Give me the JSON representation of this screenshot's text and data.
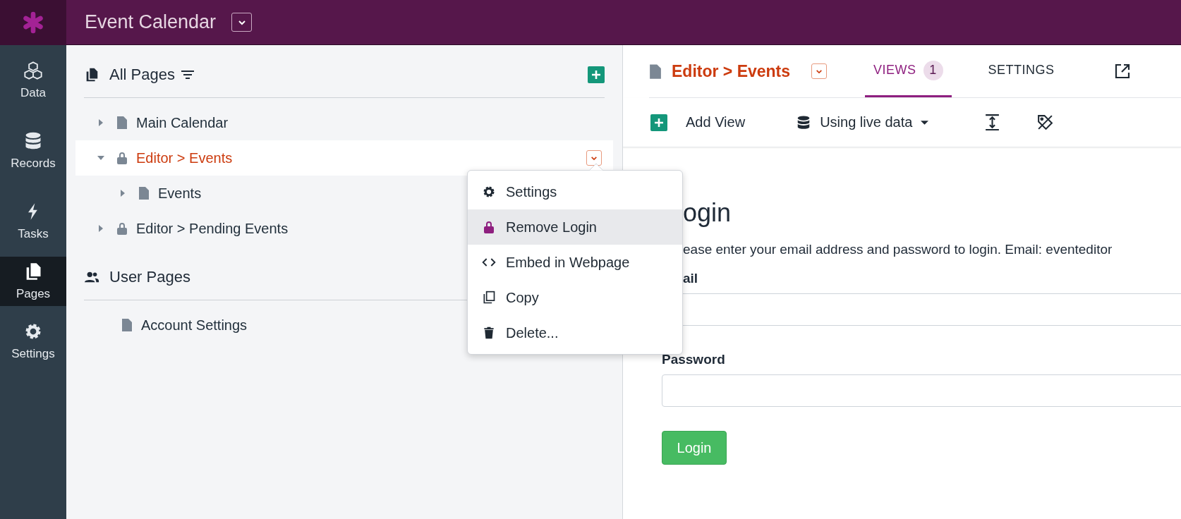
{
  "app": {
    "title": "Event Calendar"
  },
  "nav": [
    {
      "label": "Data",
      "kind": "cubes",
      "selected": false
    },
    {
      "label": "Records",
      "kind": "database",
      "selected": false
    },
    {
      "label": "Tasks",
      "kind": "bolt",
      "selected": false
    },
    {
      "label": "Pages",
      "kind": "pages",
      "selected": true
    },
    {
      "label": "Settings",
      "kind": "gear",
      "selected": false
    }
  ],
  "pages_panel": {
    "title": "All Pages",
    "tree": [
      {
        "label": "Main Calendar",
        "kind": "page",
        "expanded": false,
        "selected": false
      },
      {
        "label": "Editor > Events",
        "kind": "locked",
        "expanded": true,
        "selected": true,
        "children": [
          {
            "label": "Events",
            "kind": "page",
            "expanded": false,
            "selected": false
          }
        ]
      },
      {
        "label": "Editor > Pending Events",
        "kind": "locked",
        "expanded": false,
        "selected": false
      }
    ],
    "user_pages": {
      "title": "User Pages",
      "items": [
        {
          "label": "Account Settings",
          "kind": "page"
        }
      ]
    }
  },
  "context_menu": [
    {
      "label": "Settings",
      "kind": "gear",
      "selected": false
    },
    {
      "label": "Remove Login",
      "kind": "lock",
      "selected": true
    },
    {
      "label": "Embed in Webpage",
      "kind": "code",
      "selected": false
    },
    {
      "label": "Copy",
      "kind": "copy",
      "selected": false
    },
    {
      "label": "Delete...",
      "kind": "trash",
      "selected": false
    }
  ],
  "editor": {
    "title": "Editor > Events",
    "tabs": [
      {
        "label": "VIEWS",
        "badge": "1",
        "selected": true
      },
      {
        "label": "SETTINGS",
        "selected": false
      }
    ],
    "toolbar": {
      "add": "Add View",
      "data_source": "Using live data"
    }
  },
  "login_form": {
    "heading": "ogin",
    "description": "ease enter your email address and password to login. Email: eventeditor",
    "email_label": "ail",
    "password_label": "Password",
    "button": "Login"
  }
}
